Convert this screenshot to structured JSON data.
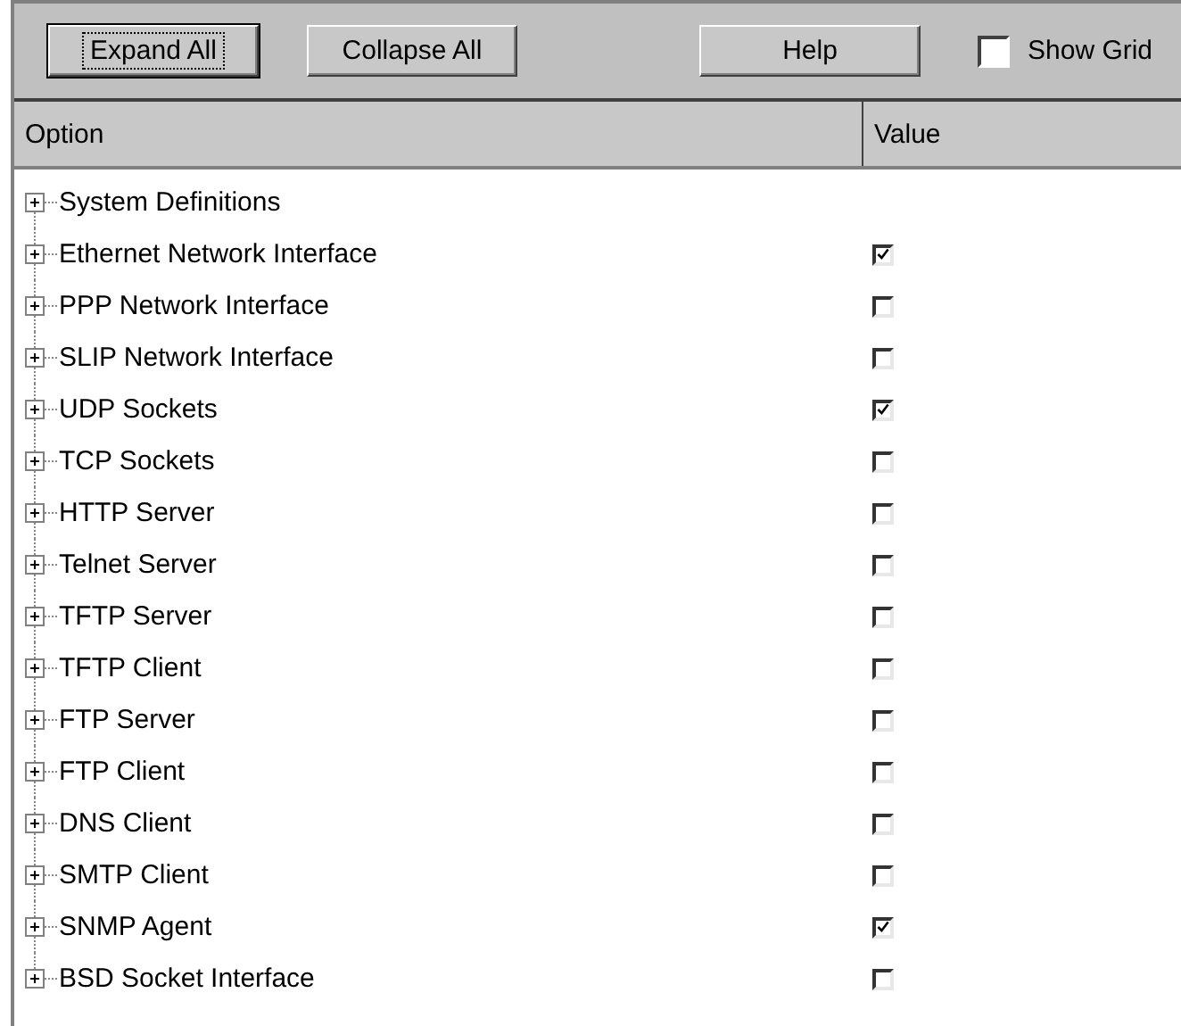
{
  "toolbar": {
    "buttons": [
      {
        "label": "Expand All",
        "focused": true
      },
      {
        "label": "Collapse All",
        "focused": false
      },
      {
        "label": "Help",
        "focused": false
      }
    ],
    "show_grid": {
      "label": "Show Grid",
      "checked": false
    }
  },
  "table": {
    "columns": [
      "Option",
      "Value"
    ],
    "rows": [
      {
        "label": "System Definitions",
        "expanded": false
      },
      {
        "label": "Ethernet Network Interface",
        "expanded": false,
        "checked": true
      },
      {
        "label": "PPP Network Interface",
        "expanded": false,
        "checked": false
      },
      {
        "label": "SLIP Network Interface",
        "expanded": false,
        "checked": false
      },
      {
        "label": "UDP Sockets",
        "expanded": false,
        "checked": true
      },
      {
        "label": "TCP Sockets",
        "expanded": false,
        "checked": false
      },
      {
        "label": "HTTP Server",
        "expanded": false,
        "checked": false
      },
      {
        "label": "Telnet Server",
        "expanded": false,
        "checked": false
      },
      {
        "label": "TFTP Server",
        "expanded": false,
        "checked": false
      },
      {
        "label": "TFTP Client",
        "expanded": false,
        "checked": false
      },
      {
        "label": "FTP Server",
        "expanded": false,
        "checked": false
      },
      {
        "label": "FTP Client",
        "expanded": false,
        "checked": false
      },
      {
        "label": "DNS Client",
        "expanded": false,
        "checked": false
      },
      {
        "label": "SMTP Client",
        "expanded": false,
        "checked": false
      },
      {
        "label": "SNMP Agent",
        "expanded": false,
        "checked": true
      },
      {
        "label": "BSD Socket Interface",
        "expanded": false,
        "checked": false
      }
    ]
  }
}
